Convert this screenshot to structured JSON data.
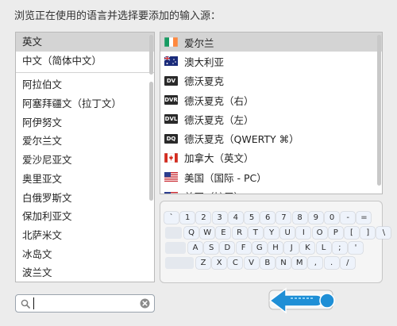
{
  "dialog": {
    "title": "浏览正在使用的语言并选择要添加的输入源："
  },
  "languages": {
    "selected_index": 0,
    "top_group": [
      "英文",
      "中文（简体中文）"
    ],
    "items": [
      "阿拉伯文",
      "阿塞拜疆文（拉丁文）",
      "阿伊努文",
      "爱尔兰文",
      "爱沙尼亚文",
      "奥里亚文",
      "白俄罗斯文",
      "保加利亚文",
      "北萨米文",
      "冰岛文",
      "波兰文"
    ]
  },
  "input_sources": {
    "selected_index": 0,
    "items": [
      {
        "label": "爱尔兰",
        "icon": "ireland-flag-icon"
      },
      {
        "label": "澳大利亚",
        "icon": "australia-flag-icon"
      },
      {
        "label": "德沃夏克",
        "icon": "dvorak-icon",
        "icon_text": "DV"
      },
      {
        "label": "德沃夏克（右）",
        "icon": "dvorak-right-icon",
        "icon_text": "DVR"
      },
      {
        "label": "德沃夏克（左）",
        "icon": "dvorak-left-icon",
        "icon_text": "DVL"
      },
      {
        "label": "德沃夏克（QWERTY ⌘）",
        "icon": "dvorak-qwerty-icon",
        "icon_text": "DQ"
      },
      {
        "label": "加拿大（英文）",
        "icon": "canada-flag-icon"
      },
      {
        "label": "美国（国际 - PC）",
        "icon": "us-flag-icon"
      },
      {
        "label": "美国（扩展）",
        "icon": "us-flag-icon"
      }
    ]
  },
  "keyboard_preview": {
    "rows": [
      [
        "`",
        "1",
        "2",
        "3",
        "4",
        "5",
        "6",
        "7",
        "8",
        "9",
        "0",
        "-",
        "="
      ],
      [
        "Q",
        "W",
        "E",
        "R",
        "T",
        "Y",
        "U",
        "I",
        "O",
        "P",
        "[",
        "]",
        "\\"
      ],
      [
        "A",
        "S",
        "D",
        "F",
        "G",
        "H",
        "J",
        "K",
        "L",
        ";",
        "'"
      ],
      [
        "Z",
        "X",
        "C",
        "V",
        "B",
        "N",
        "M",
        ",",
        ".",
        "/"
      ]
    ]
  },
  "search": {
    "value": ""
  },
  "colors": {
    "selection": "#d4d4d4",
    "arrow": "#1f8fd6"
  }
}
